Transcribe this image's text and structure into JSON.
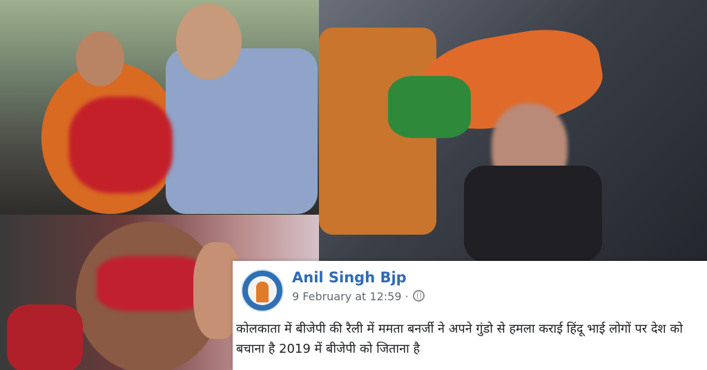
{
  "post": {
    "author": "Anil Singh Bjp",
    "timestamp": "9 February at 12:59 ·",
    "privacy_icon": "globe-icon",
    "text": "कोलकाता में बीजेपी की रैली में ममता बनर्जी ने अपने गुंडो से हमला कराई हिंदू भाई लोगों पर देश को बचाना है 2019 में बीजेपी को जिताना है"
  },
  "photos": [
    {
      "id": "photo-top-left",
      "alt": "injured-man-photo"
    },
    {
      "id": "photo-right",
      "alt": "woman-with-flag-photo"
    },
    {
      "id": "photo-bottom-left",
      "alt": "injured-woman-photo"
    }
  ],
  "colors": {
    "link": "#2f69b8",
    "meta": "#616770",
    "text": "#1c1e21"
  }
}
